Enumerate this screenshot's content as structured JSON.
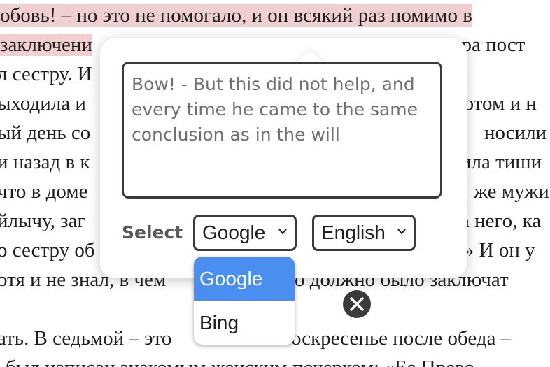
{
  "background_text": {
    "lines": [
      {
        "pre": "",
        "hl": "обовь! – но это не помогало, и он всякий раз помимо в",
        "post": ""
      },
      {
        "pre": "",
        "hl": " заключени",
        "post": "естра пост"
      },
      {
        "pre": "л сестру. И",
        "hl": "",
        "post": ""
      },
      {
        "pre": "ыходила и",
        "hl": "",
        "post": "котом и н"
      },
      {
        "pre": "ый день со",
        "hl": "",
        "post": "носили к"
      },
      {
        "pre": "и назад в к",
        "hl": "",
        "post": "ила тиши"
      },
      {
        "pre": "что в доме",
        "hl": "",
        "post": "же мужи"
      },
      {
        "pre": "йлычу, заг",
        "hl": "",
        "post": "а него, ка"
      },
      {
        "pre": "о сестру об",
        "hl": "",
        "post": "?» И он у"
      },
      {
        "pre": "отя и не знал, в чем",
        "hl": "",
        "post": "о должно было заключат"
      },
      {
        "pre": "",
        "hl": "",
        "post": ""
      },
      {
        "pre": "ать. В седьмой – это",
        "hl": "",
        "post": "оскресенье после обеда – "
      },
      {
        "pre": "был написан знакомым женским почерком: «Ее Прево",
        "hl": "",
        "post": ""
      }
    ]
  },
  "popup": {
    "translation_text": "Bow! - But this did not help, and every time he came to the same conclusion as in the will",
    "select_label": "Select",
    "engine_selected": "Google",
    "language_selected": "English",
    "engine_options": [
      "Google",
      "Bing"
    ]
  },
  "colors": {
    "highlight": "#f1cfd0",
    "selected_option": "#4a8ff0",
    "border": "#3a3a3a"
  },
  "icons": {
    "close": "close-icon",
    "chevron": "chevron-down-icon"
  }
}
